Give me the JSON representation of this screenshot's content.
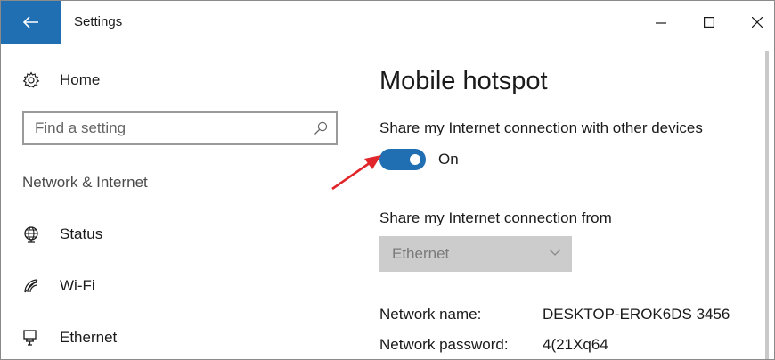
{
  "window": {
    "title": "Settings",
    "back_icon": "back-arrow-icon",
    "minimize_icon": "minimize-icon",
    "maximize_icon": "maximize-icon",
    "close_icon": "close-icon"
  },
  "sidebar": {
    "home_label": "Home",
    "home_icon": "gear-icon",
    "search": {
      "placeholder": "Find a setting",
      "value": ""
    },
    "section_label": "Network & Internet",
    "items": [
      {
        "label": "Status",
        "icon": "globe-icon"
      },
      {
        "label": "Wi-Fi",
        "icon": "wifi-icon"
      },
      {
        "label": "Ethernet",
        "icon": "ethernet-icon"
      }
    ]
  },
  "main": {
    "title": "Mobile hotspot",
    "share_label": "Share my Internet connection with other devices",
    "toggle": {
      "state_label": "On",
      "checked": true
    },
    "from_label": "Share my Internet connection from",
    "from_dropdown": {
      "selected": "Ethernet",
      "enabled": false
    },
    "network_name_label": "Network name:",
    "network_name_value": "DESKTOP-EROK6DS 3456",
    "network_password_label": "Network password:",
    "network_password_value": "4(21Xq64"
  },
  "colors": {
    "accent": "#1f6fb2",
    "annotation_arrow": "#e0262a",
    "dropdown_disabled": "#cccccc"
  }
}
